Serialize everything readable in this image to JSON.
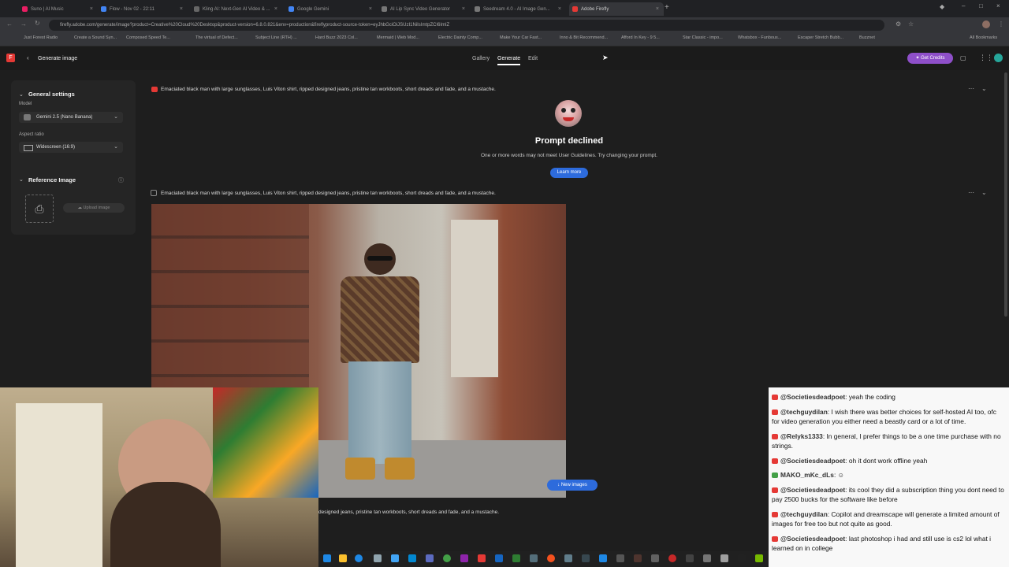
{
  "browser": {
    "tabs": [
      {
        "title": "Suno | AI Music",
        "color": "#e91e63"
      },
      {
        "title": "Flow - Nov 02 - 22:11",
        "color": "#4285f4"
      },
      {
        "title": "Kling AI: Next-Gen AI Video & ...",
        "color": "#555"
      },
      {
        "title": "Google Gemini",
        "color": "#4285f4"
      },
      {
        "title": "AI Lip Sync Video Generator",
        "color": "#777"
      },
      {
        "title": "Seedream 4.0 - AI Image Gen...",
        "color": "#777"
      },
      {
        "title": "Adobe Firefly",
        "color": "#e53935"
      }
    ],
    "url": "firefly.adobe.com/generate/image?product=Creative%20Cloud%20Desktop&product-version=6.8.0.821&env=production&fireflyproduct-source-token=eyJhbGciOiJSUzI1NiIsImtpZCI6ImlZ",
    "bookmarks": [
      "Just Forest Radio",
      "Create a Sound Syn...",
      "Composed Speed Te...",
      "The virtual of Defect...",
      "Subject Line (RTH) ...",
      "Hard Buzz 2023 Col...",
      "Mermaid | Web Mod...",
      "Electric Dainty Comp...",
      "Make Your Car Fast...",
      "Inno & Bit Recommend...",
      "Afford In Key - 9 5...",
      "Star Classic - impo...",
      "Whatsbox - Funbous...",
      "Escaper Stretch Bubb...",
      "Buzznet",
      "All Bookmarks"
    ]
  },
  "app": {
    "title": "Generate image",
    "nav": [
      "Gallery",
      "Generate",
      "Edit"
    ],
    "get_credits": "Get Credits"
  },
  "sidebar": {
    "general_settings": "General settings",
    "model_label": "Model",
    "model_value": "Gemini 2.5 (Nano Banana)",
    "aspect_label": "Aspect ratio",
    "aspect_value": "Widescreen (16:9)",
    "reference_image": "Reference Image",
    "upload_image": "Upload image"
  },
  "main": {
    "prompt_1": "Emaciated black man with large sunglasses, Luis Viton shirt, ripped designed jeans, pristine tan workboots, short dreads and fade, and a mustache.",
    "declined_title": "Prompt declined",
    "declined_msg": "One or more words may not meet User Guidelines. Try changing your prompt.",
    "learn_more": "Learn more",
    "prompt_2": "Emaciated black man with large sunglasses, Luis Viton shirt, ripped designed jeans, pristine tan workboots, short dreads and fade, and a mustache.",
    "new_images": "New images",
    "prompt_input": "designed jeans, pristine tan workboots, short dreads and fade, and a mustache."
  },
  "chat": [
    {
      "user": "@Societiesdeadpoet",
      "text": ": yeah the coding"
    },
    {
      "user": "@techguydilan",
      "text": ": I wish there was better choices for self-hosted AI too, ofc for video generation you either need a beastly card or a lot of time."
    },
    {
      "user": "@Relyks1333",
      "text": ": In general, I prefer things to be a one time purchase with no strings."
    },
    {
      "user": "@Societiesdeadpoet",
      "text": ": oh it dont work offline yeah"
    },
    {
      "user": "MAKO_mKc_dLs",
      "text": ":"
    },
    {
      "user": "@Societiesdeadpoet",
      "text": ": its cool they did a subscription thing you dont need to pay 2500 bucks for the software like before"
    },
    {
      "user": "@techguydilan",
      "text": ": Copilot and dreamscape will generate a limited amount of images for free too but not quite as good."
    },
    {
      "user": "@Societiesdeadpoet",
      "text": ": last photoshop i had and still use is cs2 lol what i learned on in college"
    }
  ],
  "colors": {
    "accent": "#2d6bdc",
    "credits": "#8e4fc9",
    "firefly_red": "#e53935"
  }
}
